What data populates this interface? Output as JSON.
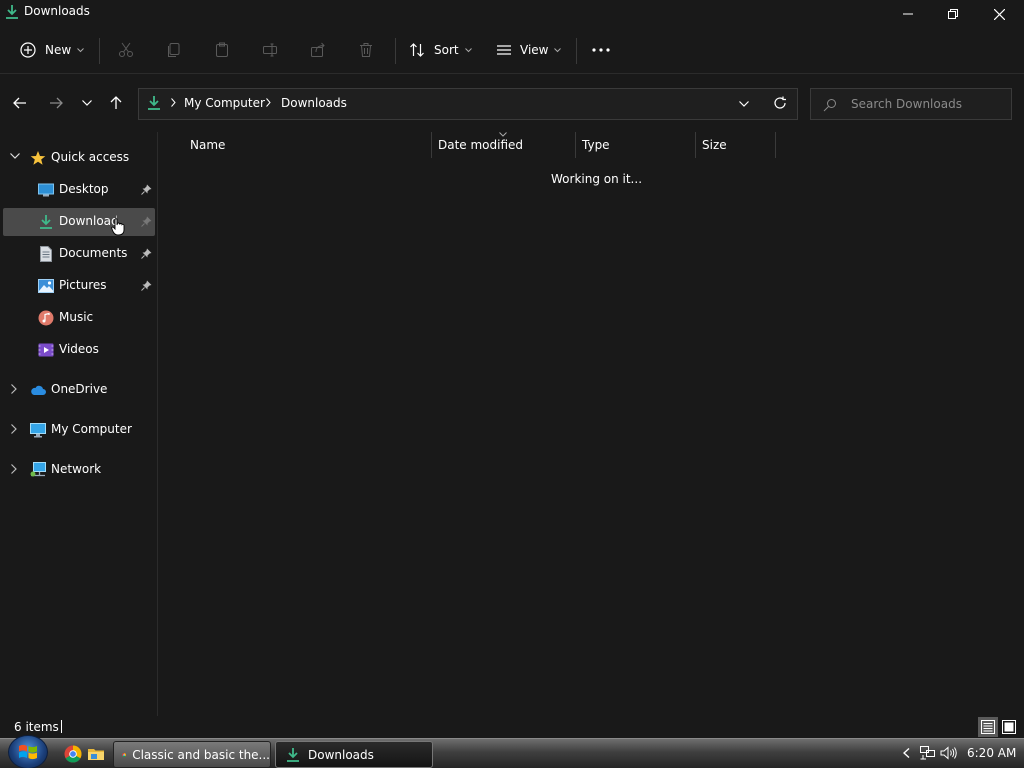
{
  "window": {
    "title": "Downloads"
  },
  "toolbar": {
    "new_label": "New",
    "sort_label": "Sort",
    "view_label": "View"
  },
  "address": {
    "crumbs": [
      "My Computer",
      "Downloads"
    ]
  },
  "search": {
    "placeholder": "Search Downloads"
  },
  "sidebar": {
    "items": [
      {
        "label": "Quick access",
        "icon": "star-icon"
      },
      {
        "label": "Desktop",
        "icon": "desktop-icon",
        "pinned": true
      },
      {
        "label": "Downloads",
        "icon": "download-icon",
        "pinned": true,
        "selected": true
      },
      {
        "label": "Documents",
        "icon": "documents-icon",
        "pinned": true
      },
      {
        "label": "Pictures",
        "icon": "pictures-icon",
        "pinned": true
      },
      {
        "label": "Music",
        "icon": "music-icon"
      },
      {
        "label": "Videos",
        "icon": "videos-icon"
      },
      {
        "label": "OneDrive",
        "icon": "cloud-icon"
      },
      {
        "label": "My Computer",
        "icon": "computer-icon"
      },
      {
        "label": "Network",
        "icon": "network-icon"
      }
    ]
  },
  "columns": [
    "Name",
    "Date modified",
    "Type",
    "Size"
  ],
  "content": {
    "status_message": "Working on it..."
  },
  "status": {
    "item_count": "6 items"
  },
  "taskbar": {
    "tasks": [
      {
        "label": "Classic and basic the...",
        "icon": "chrome-icon"
      },
      {
        "label": "Downloads",
        "icon": "download-icon",
        "active": true
      }
    ],
    "clock": "6:20 AM"
  },
  "colors": {
    "background": "#191919",
    "selection": "#4a4a4a",
    "download_green": "#3fb98a"
  }
}
